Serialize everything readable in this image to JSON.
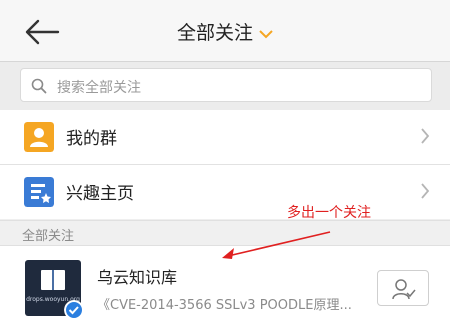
{
  "header": {
    "title": "全部关注"
  },
  "search": {
    "placeholder": "搜索全部关注"
  },
  "menu": [
    {
      "label": "我的群",
      "icon": "group-icon",
      "color": "#f5a623"
    },
    {
      "label": "兴趣主页",
      "icon": "interest-page-icon",
      "color": "#3a7bd5"
    }
  ],
  "section": {
    "title": "全部关注"
  },
  "annotation": {
    "text": "多出一个关注"
  },
  "account": {
    "name": "乌云知识库",
    "subtitle": "《CVE-2014-3566 SSLv3 POODLE原理...",
    "avatar_caption": "drops.wooyun.org"
  },
  "colors": {
    "accent": "#f5a623",
    "annotation": "#e02020",
    "verified": "#2b7fe0"
  }
}
